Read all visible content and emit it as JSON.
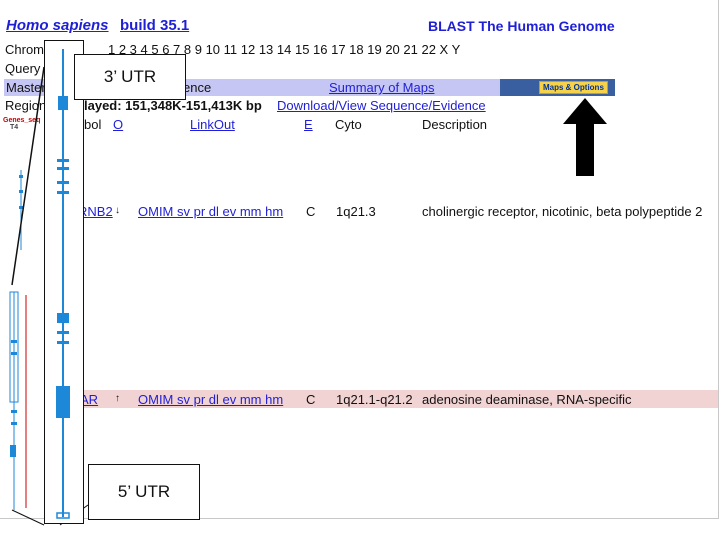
{
  "header": {
    "species": "Homo sapiens",
    "build": "build 35.1",
    "blast_link": "BLAST The Human Genome"
  },
  "rows": {
    "chrom_label": "Chrom",
    "chrom_list": "1 2 3 4 5 6 7 8 9 10 11 12 13 14 15 16 17 18 19 20 21 22 X Y",
    "query_label": "Query",
    "master_label": "Master",
    "master_tail": "ence",
    "summary_link": "Summary of Maps",
    "maps_options": "Maps & Options",
    "region_label": "Region",
    "region_text": "layed: 151,348K-151,413K bp",
    "download_link": "Download/View Sequence/Evidence",
    "genes_mini": "Genes_seq",
    "genes_mini_sub": "T4",
    "col_symbol": "bol",
    "col_o": "O",
    "col_linkout": "LinkOut",
    "col_e": "E",
    "col_cyto": "Cyto",
    "col_description": "Description"
  },
  "genes": [
    {
      "symbol": "RNB2",
      "arrow": "↓",
      "linkout": "OMIM sv pr dl ev mm hm",
      "evidence": "C",
      "cyto": "1q21.3",
      "description": "cholinergic receptor, nicotinic, beta polypeptide 2",
      "highlight": false
    },
    {
      "symbol": "AR",
      "arrow": "↑",
      "linkout": "OMIM sv pr dl ev mm hm",
      "evidence": "C",
      "cyto": "1q21.1-q21.2",
      "description": "adenosine deaminase, RNA-specific",
      "highlight": true
    }
  ],
  "callouts": {
    "top": "3’ UTR",
    "bottom": "5’ UTR"
  },
  "colors": {
    "link": "#1f1fd6",
    "header_band": "#c6c6f5",
    "pink_band": "#f1d3d3",
    "gene_blue": "#1e88d8",
    "callout_red": "#cc0000"
  }
}
